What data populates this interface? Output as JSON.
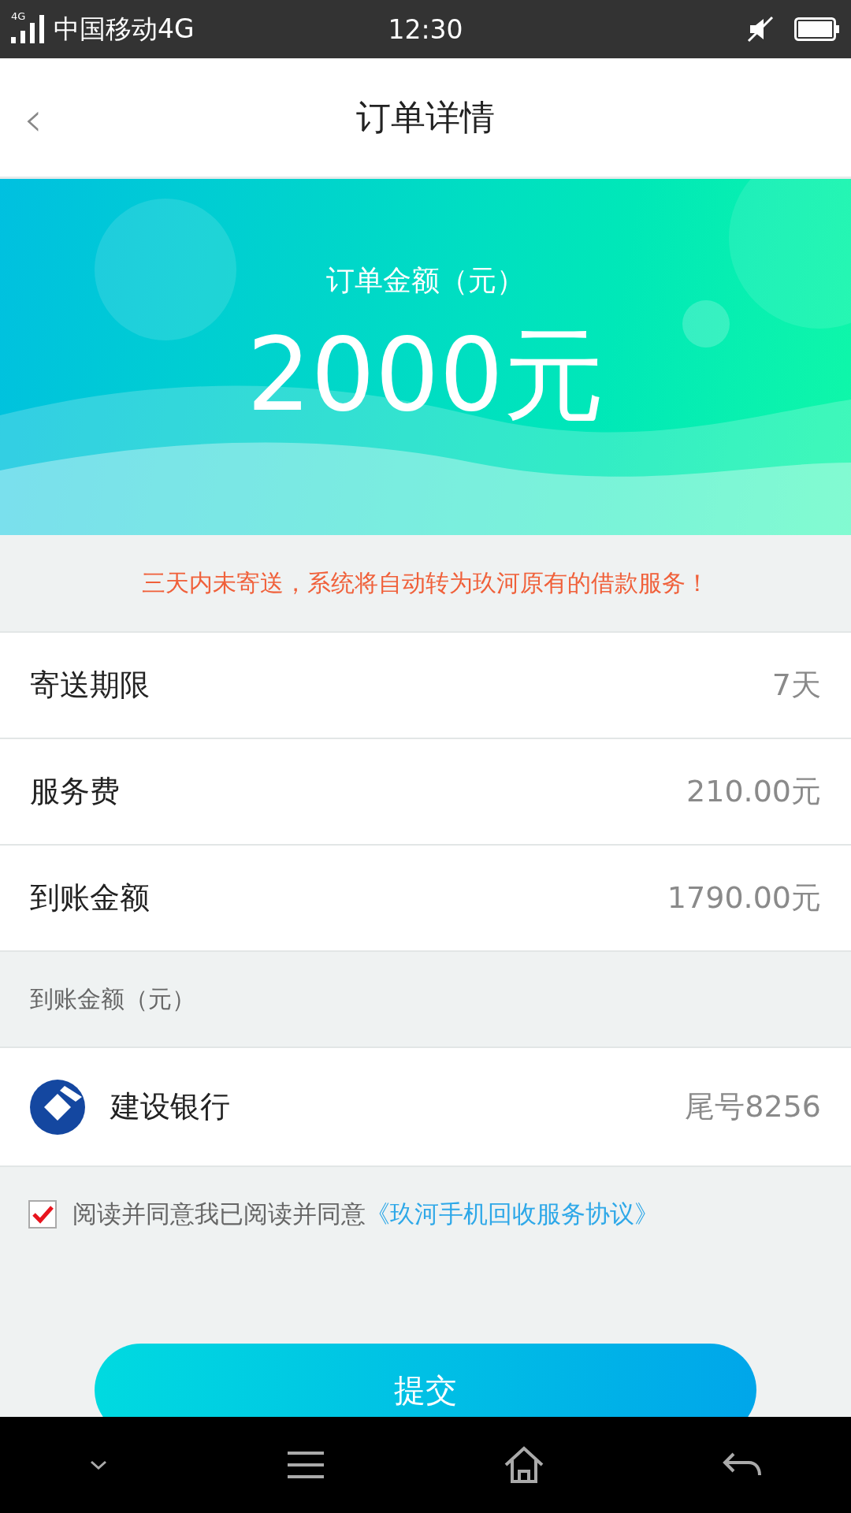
{
  "status_bar": {
    "network_badge": "4G",
    "carrier": "中国移动4G",
    "time": "12:30"
  },
  "header": {
    "back": "‹",
    "title": "订单详情"
  },
  "banner": {
    "label": "订单金额（元）",
    "amount": "2000元"
  },
  "notice": "三天内未寄送，系统将自动转为玖河原有的借款服务！",
  "details": [
    {
      "label": "寄送期限",
      "value": "7天"
    },
    {
      "label": "服务费",
      "value": "210.00元"
    },
    {
      "label": "到账金额",
      "value": "1790.00元"
    }
  ],
  "section_label": "到账金额（元）",
  "bank": {
    "name": "建设银行",
    "tail": "尾号8256"
  },
  "agreement": {
    "checked": true,
    "text": "阅读并同意我已阅读并同意",
    "link": "《玖河手机回收服务协议》"
  },
  "submit": "提交"
}
